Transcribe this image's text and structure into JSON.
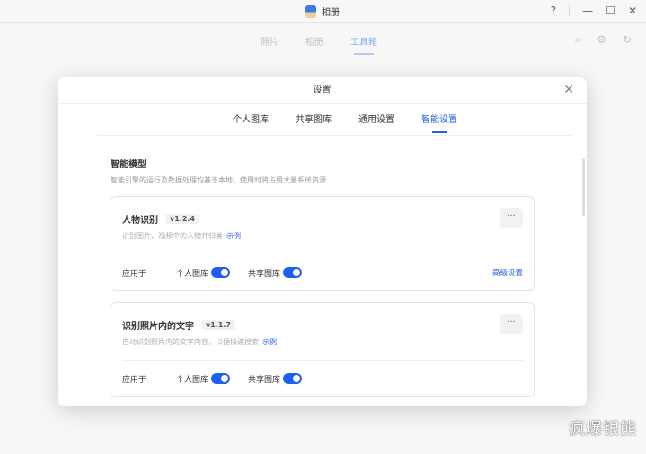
{
  "app": {
    "title": "相册"
  },
  "window": {
    "help": "?",
    "minimize": "—",
    "maximize": "☐",
    "close": "✕"
  },
  "nav": {
    "tabs": [
      "照片",
      "相册",
      "工具箱"
    ],
    "active": "工具箱"
  },
  "dialog": {
    "title": "设置",
    "close": "✕",
    "tabs": [
      "个人图库",
      "共享图库",
      "通用设置",
      "智能设置"
    ],
    "active_tab": "智能设置",
    "section": {
      "title": "智能模型",
      "desc": "智能引擎的运行及数据处理均基于本地，使用时将占用大量系统资源"
    },
    "cards": [
      {
        "name": "人物识别",
        "version": "v1.2.4",
        "desc": "识别图片、视频中的人物并归类",
        "example": "示例",
        "apply_label": "应用于",
        "toggles": [
          {
            "label": "个人图库",
            "on": true
          },
          {
            "label": "共享图库",
            "on": true
          }
        ],
        "advanced": "高级设置"
      },
      {
        "name": "识别照片内的文字",
        "version": "v1.1.7",
        "desc": "自动识别照片内的文字内容，以便快速搜索",
        "example": "示例",
        "apply_label": "应用于",
        "toggles": [
          {
            "label": "个人图库",
            "on": true
          },
          {
            "label": "共享图库",
            "on": true
          }
        ]
      }
    ]
  },
  "watermark": "疯爆银熊"
}
